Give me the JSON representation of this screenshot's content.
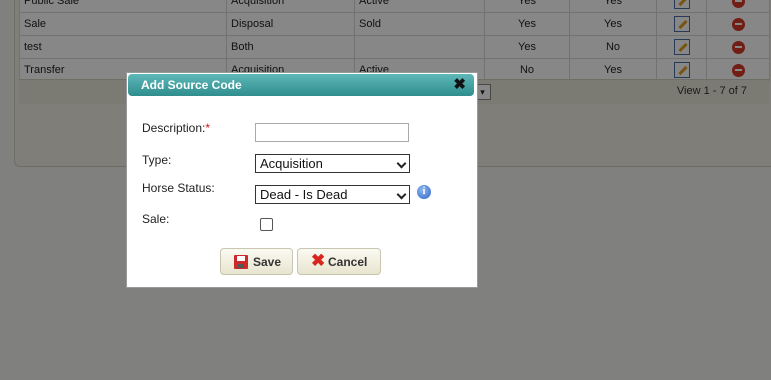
{
  "grid": {
    "rows": [
      {
        "name": "Public Sale",
        "type": "Acquisition",
        "status": "Active",
        "col4": "Yes",
        "col5": "Yes"
      },
      {
        "name": "Sale",
        "type": "Disposal",
        "status": "Sold",
        "col4": "Yes",
        "col5": "Yes"
      },
      {
        "name": "test",
        "type": "Both",
        "status": "",
        "col4": "Yes",
        "col5": "No"
      },
      {
        "name": "Transfer",
        "type": "Acquisition",
        "status": "Active",
        "col4": "No",
        "col5": "Yes"
      }
    ],
    "pager_text": "View 1 - 7 of 7"
  },
  "dialog": {
    "title": "Add Source Code",
    "close_glyph": "✖",
    "description_label": "Description:",
    "required_mark": "*",
    "description_value": "",
    "type_label": "Type:",
    "type_value": "Acquisition",
    "horse_status_label": "Horse Status:",
    "horse_status_value": "Dead - Is Dead",
    "info_glyph": "i",
    "sale_label": "Sale:",
    "sale_checked": false,
    "save_label": "Save",
    "cancel_label": "Cancel"
  },
  "colors": {
    "titlebar": "#2f8d8e",
    "overlay": "rgba(0,0,0,0.47)",
    "delete": "#d63a2a"
  },
  "icons": [
    "edit-icon",
    "delete-icon",
    "close-icon",
    "info-icon",
    "floppy-disk-icon",
    "x-icon"
  ]
}
